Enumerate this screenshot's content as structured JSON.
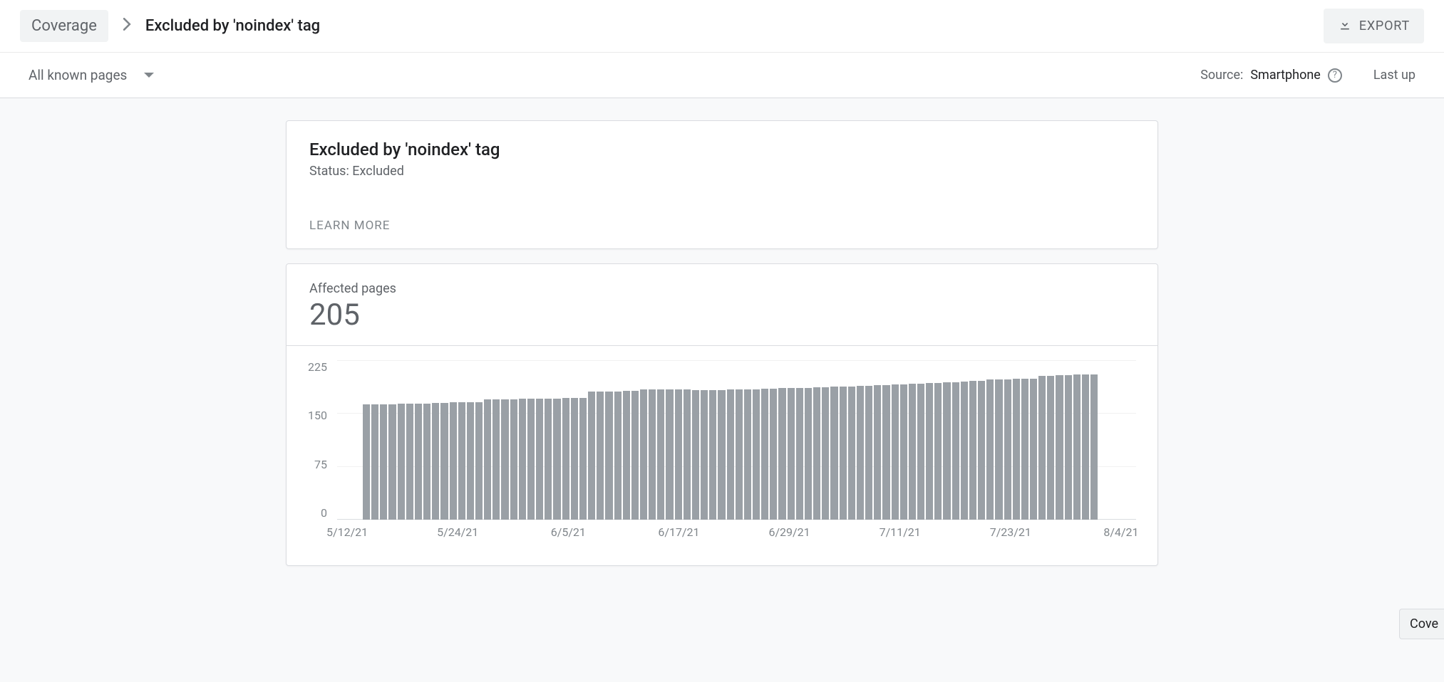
{
  "breadcrumb": {
    "root": "Coverage",
    "current": "Excluded by 'noindex' tag"
  },
  "export_label": "EXPORT",
  "filter": {
    "label": "All known pages"
  },
  "source": {
    "prefix": "Source:",
    "value": "Smartphone",
    "last_updated_prefix": "Last up"
  },
  "info_card": {
    "title": "Excluded by 'noindex' tag",
    "status": "Status: Excluded",
    "learn_more": "LEARN MORE"
  },
  "chart": {
    "label": "Affected pages",
    "value": "205"
  },
  "floater_label": "Cove",
  "chart_data": {
    "type": "bar",
    "title": "Affected pages",
    "xlabel": "",
    "ylabel": "",
    "ylim": [
      0,
      225
    ],
    "y_ticks": [
      225,
      150,
      75,
      0
    ],
    "x_ticks": [
      {
        "label": "5/12/21",
        "pos_pct": 1
      },
      {
        "label": "5/24/21",
        "pos_pct": 15
      },
      {
        "label": "6/5/21",
        "pos_pct": 29
      },
      {
        "label": "6/17/21",
        "pos_pct": 43
      },
      {
        "label": "6/29/21",
        "pos_pct": 57
      },
      {
        "label": "7/11/21",
        "pos_pct": 71
      },
      {
        "label": "7/23/21",
        "pos_pct": 85
      },
      {
        "label": "8/4/21",
        "pos_pct": 99
      }
    ],
    "values": [
      163,
      163,
      163,
      163,
      164,
      164,
      164,
      164,
      165,
      165,
      166,
      166,
      166,
      166,
      170,
      170,
      170,
      170,
      171,
      171,
      171,
      171,
      171,
      172,
      172,
      172,
      181,
      181,
      181,
      181,
      182,
      182,
      184,
      184,
      184,
      184,
      184,
      184,
      183,
      183,
      183,
      183,
      184,
      184,
      184,
      184,
      185,
      185,
      186,
      186,
      186,
      186,
      187,
      187,
      188,
      188,
      188,
      189,
      189,
      190,
      190,
      191,
      191,
      192,
      192,
      193,
      193,
      194,
      194,
      195,
      196,
      196,
      198,
      198,
      198,
      199,
      199,
      199,
      203,
      203,
      204,
      204,
      205,
      205,
      205
    ]
  }
}
